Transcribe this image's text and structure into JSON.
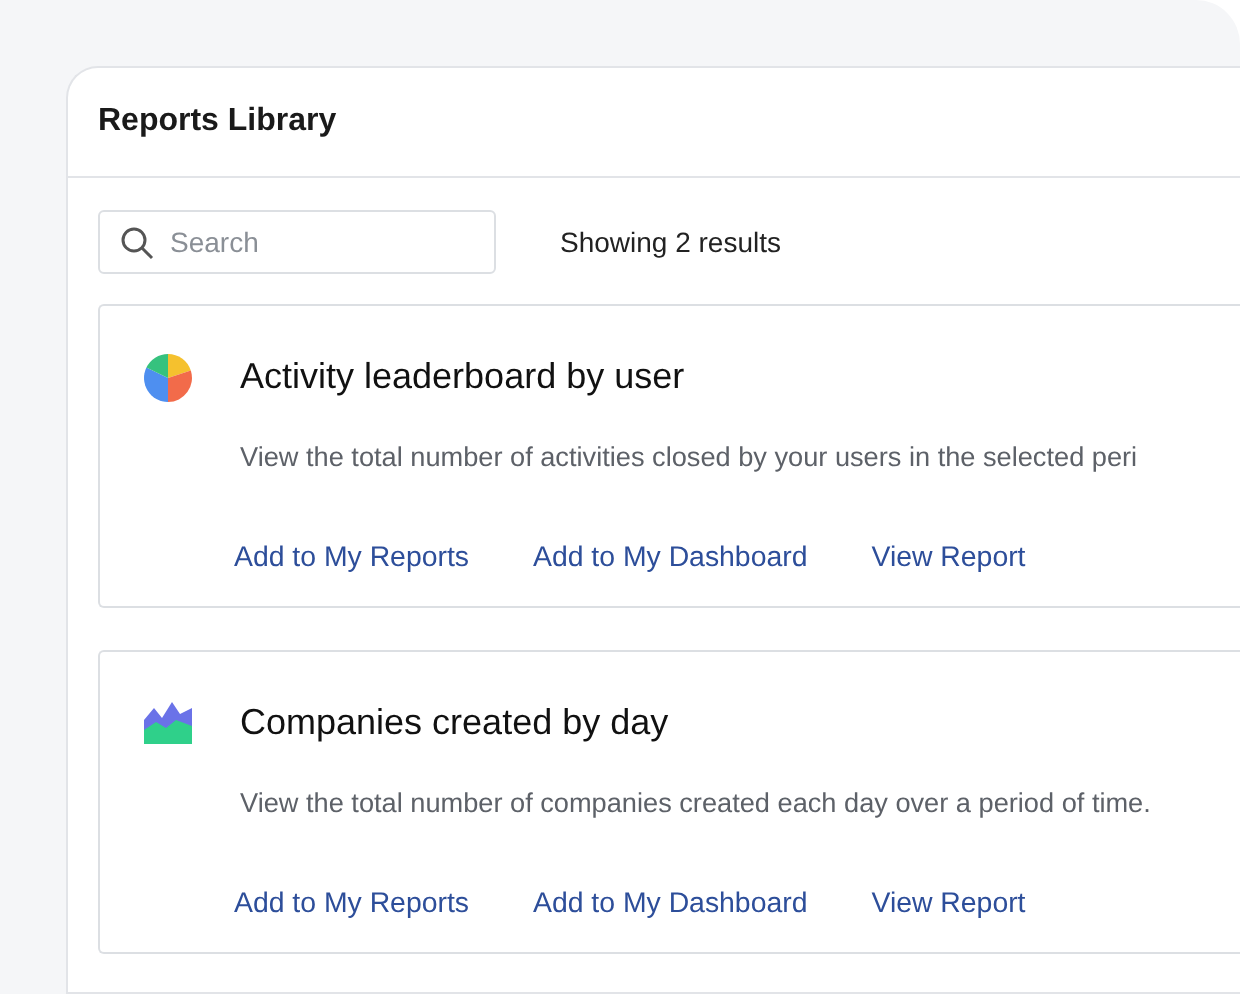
{
  "panel": {
    "title": "Reports Library"
  },
  "search": {
    "placeholder": "Search"
  },
  "results_count": "Showing 2 results",
  "reports": [
    {
      "kind": "pie",
      "title": "Activity leaderboard by user",
      "description": "View the total number of activities closed by your users in the selected peri",
      "actions": [
        "Add to My Reports",
        "Add to My Dashboard",
        "View Report"
      ]
    },
    {
      "kind": "area",
      "title": "Companies created by day",
      "description": "View the total number of companies created each day over a period of time.",
      "actions": [
        "Add to My Reports",
        "Add to My Dashboard",
        "View Report"
      ]
    }
  ]
}
